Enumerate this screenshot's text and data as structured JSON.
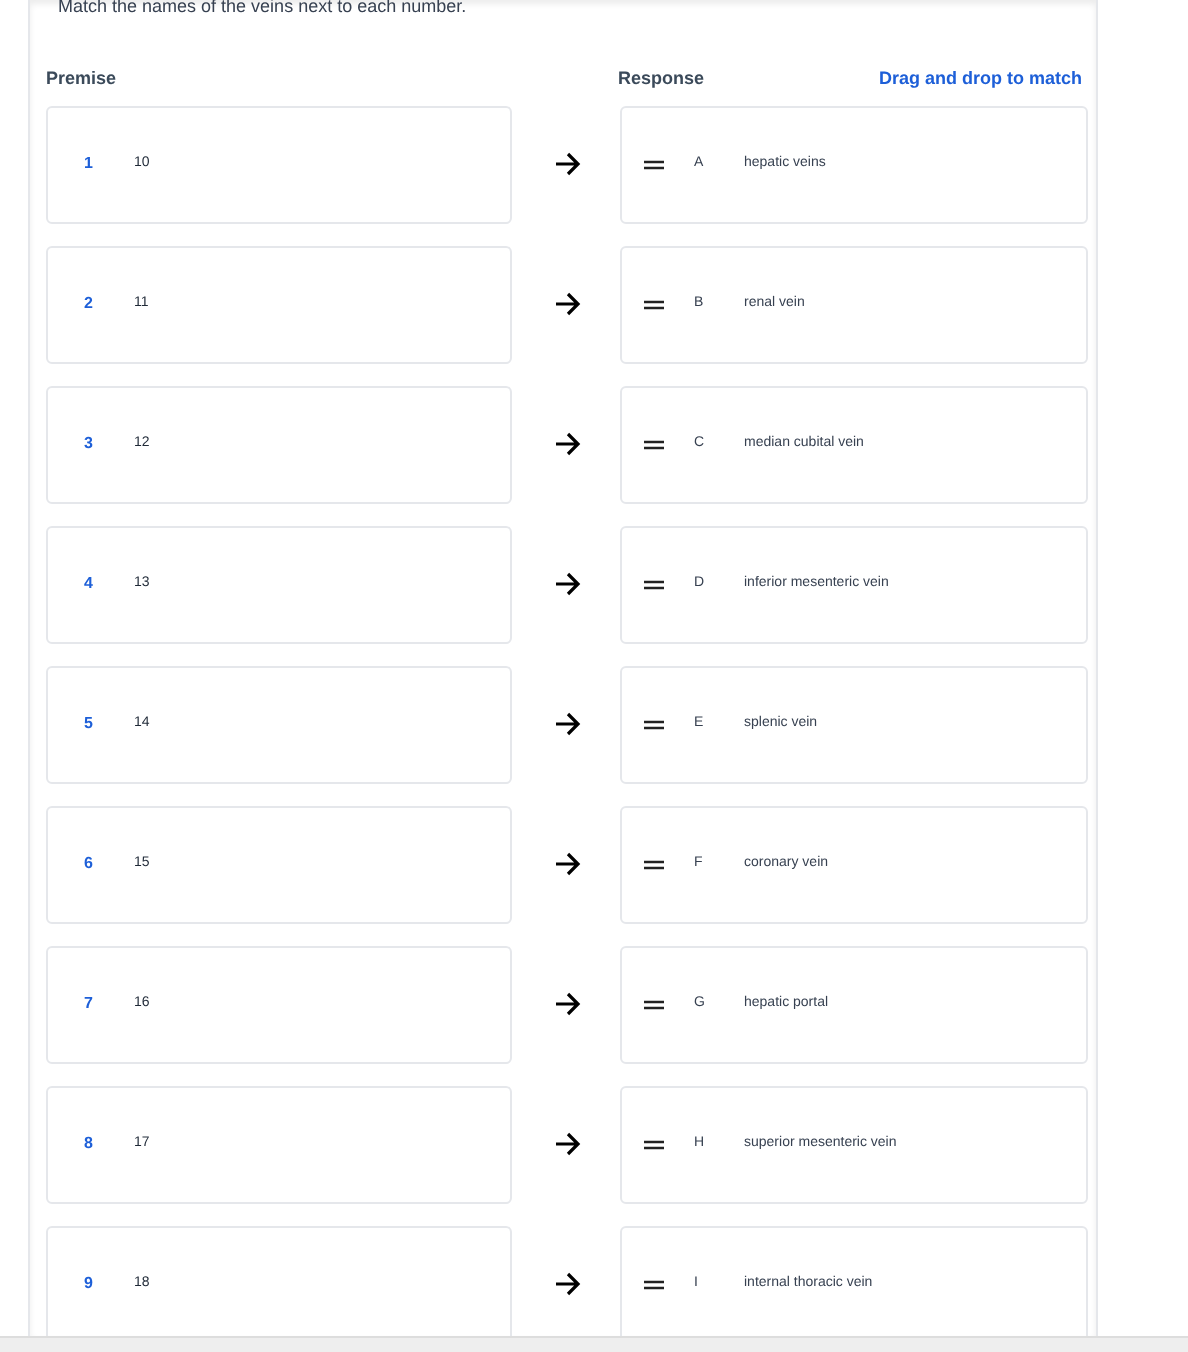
{
  "instruction": "Match the names of the veins next to each number.",
  "headers": {
    "premise": "Premise",
    "response": "Response",
    "hint": "Drag and drop to match"
  },
  "pairs": [
    {
      "number": "1",
      "premise": "10",
      "letter": "A",
      "response": "hepatic veins"
    },
    {
      "number": "2",
      "premise": "11",
      "letter": "B",
      "response": "renal vein"
    },
    {
      "number": "3",
      "premise": "12",
      "letter": "C",
      "response": "median cubital vein"
    },
    {
      "number": "4",
      "premise": "13",
      "letter": "D",
      "response": "inferior mesenteric vein"
    },
    {
      "number": "5",
      "premise": "14",
      "letter": "E",
      "response": "splenic vein"
    },
    {
      "number": "6",
      "premise": "15",
      "letter": "F",
      "response": "coronary vein"
    },
    {
      "number": "7",
      "premise": "16",
      "letter": "G",
      "response": "hepatic portal"
    },
    {
      "number": "8",
      "premise": "17",
      "letter": "H",
      "response": "superior mesenteric vein"
    },
    {
      "number": "9",
      "premise": "18",
      "letter": "I",
      "response": "internal thoracic vein"
    }
  ]
}
